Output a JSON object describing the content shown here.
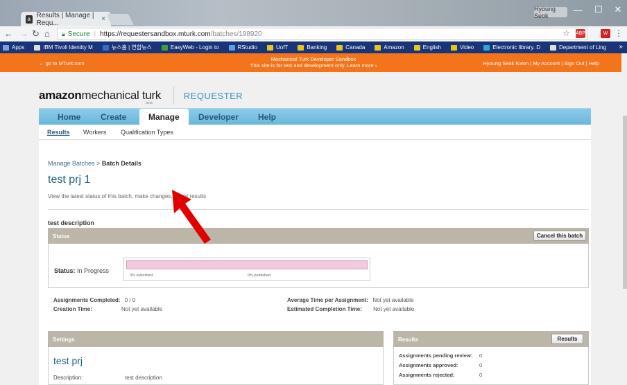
{
  "browser": {
    "tab_title": "Results | Manage | Requ...",
    "tab_close": "×",
    "profile_name": "Hyoung Seok",
    "win_min": "—",
    "win_max": "☐",
    "win_close": "✕",
    "secure_label": "Secure",
    "url_host": "https://requestersandbox.mturk.com",
    "url_path": "/batches/198920",
    "ext1_label": "ABP",
    "ext2_label": "W"
  },
  "bookmarks": [
    {
      "label": "Apps",
      "color": "#7aa0e0"
    },
    {
      "label": "IBM Tivoli Identity M",
      "color": "#dddddd"
    },
    {
      "label": "뉴스홈 | 연합뉴스",
      "color": "#3b6cc5"
    },
    {
      "label": "EasyWeb - Login to",
      "color": "#3aa13a"
    },
    {
      "label": "RStudio",
      "color": "#5aa0e8"
    },
    {
      "label": "UofT",
      "color": "#e8c420"
    },
    {
      "label": "Banking",
      "color": "#e8c420"
    },
    {
      "label": "Canada",
      "color": "#e8c420"
    },
    {
      "label": "Amazon",
      "color": "#e8c420"
    },
    {
      "label": "English",
      "color": "#e8c420"
    },
    {
      "label": "Video",
      "color": "#e8c420"
    },
    {
      "label": "Electronic library. D",
      "color": "#2fa7d6"
    },
    {
      "label": "Department of Ling",
      "color": "#dddddd"
    }
  ],
  "bookmarks_more": "»",
  "sandbox": {
    "back_link": "← go to MTurk.com",
    "line1": "Mechanical Turk Developer Sandbox",
    "line2": "This site is for test and development only. Learn more ›",
    "user_name": "Hyoung Seok Kwon",
    "account": "My Account",
    "signout": "Sign Out",
    "help": "Help",
    "divider": " | "
  },
  "logo": {
    "amazon": "amazon",
    "mt": "mechanical turk",
    "beta": "beta",
    "requester": "REQUESTER"
  },
  "nav": {
    "home": "Home",
    "create": "Create",
    "manage": "Manage",
    "developer": "Developer",
    "help": "Help"
  },
  "subnav": {
    "results": "Results",
    "workers": "Workers",
    "qual": "Qualification Types"
  },
  "page": {
    "crumb_link": "Manage Batches",
    "crumb_sep": " > ",
    "crumb_current": "Batch Details",
    "title": "test prj 1",
    "subtitle": "View the latest status of this batch, make changes, or get results",
    "description": "test description"
  },
  "status": {
    "header": "Status",
    "cancel_button": "Cancel this batch",
    "label": "Status:",
    "value": "In Progress",
    "submitted_text": "0% submitted",
    "published_text": "0% published",
    "submitted_pct": 0,
    "published_pct": 0
  },
  "stats": {
    "assign_completed_k": "Assignments Completed:",
    "assign_completed_v": "0 / 0",
    "creation_k": "Creation Time:",
    "creation_v": "Not yet available",
    "avg_time_k": "Average Time per Assignment:",
    "avg_time_v": "Not yet available",
    "est_k": "Estimated Completion Time:",
    "est_v": "Not yet available"
  },
  "settings": {
    "header": "Settings",
    "project_title": "test prj",
    "desc_k": "Description:",
    "desc_v": "test description"
  },
  "results": {
    "header": "Results",
    "button": "Results",
    "rows": [
      {
        "k": "Assignments pending review:",
        "v": "0"
      },
      {
        "k": "Assignments approved:",
        "v": "0"
      },
      {
        "k": "Assignments rejected:",
        "v": "0"
      }
    ]
  },
  "colors": {
    "orange_bar": "#f3741b",
    "nav_blue": "#6ab6dc",
    "link_blue": "#1d5e88",
    "section_header": "#bcb6a8",
    "arrow_red": "#e00000"
  }
}
